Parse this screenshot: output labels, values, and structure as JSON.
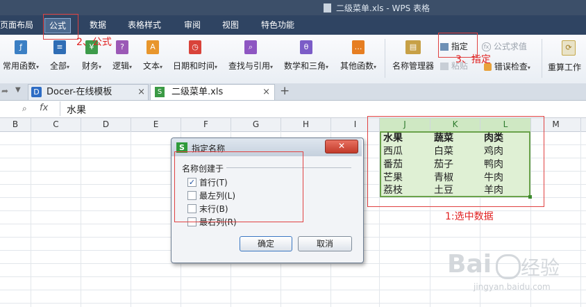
{
  "window": {
    "title": "二级菜单.xls - WPS 表格"
  },
  "menu_tabs": [
    "页面布局",
    "公式",
    "数据",
    "表格样式",
    "审阅",
    "视图",
    "特色功能"
  ],
  "ribbon": {
    "buttons": [
      {
        "label": "常用函数",
        "icon": "function-icon"
      },
      {
        "label": "全部",
        "icon": "all-functions-icon"
      },
      {
        "label": "财务",
        "icon": "finance-icon"
      },
      {
        "label": "逻辑",
        "icon": "logic-icon"
      },
      {
        "label": "文本",
        "icon": "text-icon"
      },
      {
        "label": "日期和时间",
        "icon": "datetime-icon"
      },
      {
        "label": "查找与引用",
        "icon": "lookup-icon"
      },
      {
        "label": "数学和三角",
        "icon": "math-icon"
      },
      {
        "label": "其他函数",
        "icon": "more-functions-icon"
      },
      {
        "label": "名称管理器",
        "icon": "name-manager-icon"
      },
      {
        "label": "重算工作",
        "icon": "recalc-icon"
      }
    ],
    "small": {
      "specify": "指定",
      "paste": "粘贴",
      "formula_eval": "公式求值",
      "error_check": "错误检查"
    }
  },
  "doc_tabs": [
    {
      "label": "Docer-在线模板",
      "close": "×"
    },
    {
      "label": "二级菜单.xls",
      "close": "×"
    }
  ],
  "new_tab": "+",
  "formula_bar": {
    "fx": "fx",
    "value": "水果"
  },
  "columns": [
    "B",
    "C",
    "D",
    "E",
    "F",
    "G",
    "H",
    "I",
    "J",
    "K",
    "L",
    "M"
  ],
  "grid_data": {
    "header": [
      "水果",
      "蔬菜",
      "肉类"
    ],
    "rows": [
      [
        "西瓜",
        "白菜",
        "鸡肉"
      ],
      [
        "番茄",
        "茄子",
        "鸭肉"
      ],
      [
        "芒果",
        "青椒",
        "牛肉"
      ],
      [
        "荔枝",
        "土豆",
        "羊肉"
      ]
    ]
  },
  "annotations": {
    "step1": "1:选中数据",
    "step2": "2、公式",
    "step3": "3、指定"
  },
  "dialog": {
    "title": "指定名称",
    "icon_letter": "S",
    "close": "✕",
    "group_label": "名称创建于",
    "options": [
      {
        "label": "首行(T)",
        "checked": true
      },
      {
        "label": "最左列(L)",
        "checked": false
      },
      {
        "label": "末行(B)",
        "checked": false
      },
      {
        "label": "最右列(R)",
        "checked": false
      }
    ],
    "ok": "确定",
    "cancel": "取消"
  },
  "watermark": {
    "brand": "Bai",
    "brand2": "经验",
    "url": "jingyan.baidu.com"
  }
}
